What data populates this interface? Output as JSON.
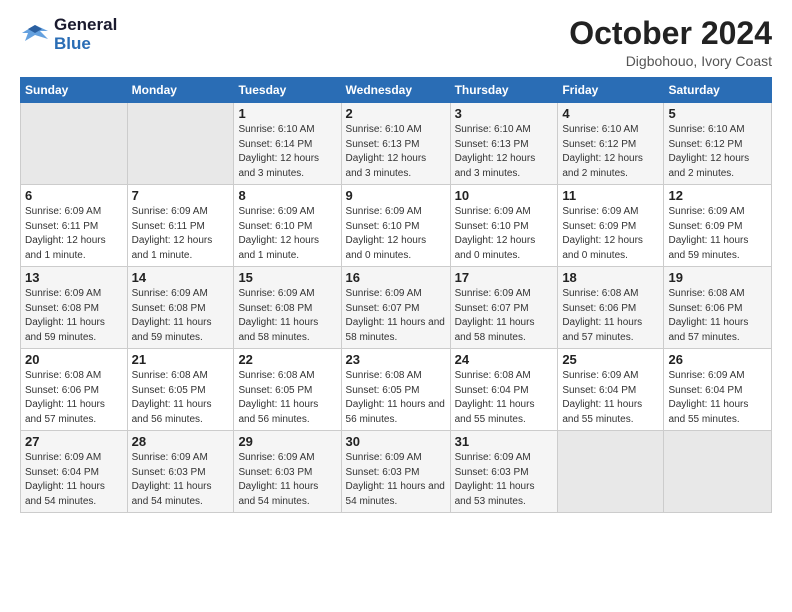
{
  "header": {
    "logo_line1": "General",
    "logo_line2": "Blue",
    "month": "October 2024",
    "location": "Digbohouo, Ivory Coast"
  },
  "weekdays": [
    "Sunday",
    "Monday",
    "Tuesday",
    "Wednesday",
    "Thursday",
    "Friday",
    "Saturday"
  ],
  "weeks": [
    [
      {
        "day": "",
        "info": ""
      },
      {
        "day": "",
        "info": ""
      },
      {
        "day": "1",
        "info": "Sunrise: 6:10 AM\nSunset: 6:14 PM\nDaylight: 12 hours and 3 minutes."
      },
      {
        "day": "2",
        "info": "Sunrise: 6:10 AM\nSunset: 6:13 PM\nDaylight: 12 hours and 3 minutes."
      },
      {
        "day": "3",
        "info": "Sunrise: 6:10 AM\nSunset: 6:13 PM\nDaylight: 12 hours and 3 minutes."
      },
      {
        "day": "4",
        "info": "Sunrise: 6:10 AM\nSunset: 6:12 PM\nDaylight: 12 hours and 2 minutes."
      },
      {
        "day": "5",
        "info": "Sunrise: 6:10 AM\nSunset: 6:12 PM\nDaylight: 12 hours and 2 minutes."
      }
    ],
    [
      {
        "day": "6",
        "info": "Sunrise: 6:09 AM\nSunset: 6:11 PM\nDaylight: 12 hours and 1 minute."
      },
      {
        "day": "7",
        "info": "Sunrise: 6:09 AM\nSunset: 6:11 PM\nDaylight: 12 hours and 1 minute."
      },
      {
        "day": "8",
        "info": "Sunrise: 6:09 AM\nSunset: 6:10 PM\nDaylight: 12 hours and 1 minute."
      },
      {
        "day": "9",
        "info": "Sunrise: 6:09 AM\nSunset: 6:10 PM\nDaylight: 12 hours and 0 minutes."
      },
      {
        "day": "10",
        "info": "Sunrise: 6:09 AM\nSunset: 6:10 PM\nDaylight: 12 hours and 0 minutes."
      },
      {
        "day": "11",
        "info": "Sunrise: 6:09 AM\nSunset: 6:09 PM\nDaylight: 12 hours and 0 minutes."
      },
      {
        "day": "12",
        "info": "Sunrise: 6:09 AM\nSunset: 6:09 PM\nDaylight: 11 hours and 59 minutes."
      }
    ],
    [
      {
        "day": "13",
        "info": "Sunrise: 6:09 AM\nSunset: 6:08 PM\nDaylight: 11 hours and 59 minutes."
      },
      {
        "day": "14",
        "info": "Sunrise: 6:09 AM\nSunset: 6:08 PM\nDaylight: 11 hours and 59 minutes."
      },
      {
        "day": "15",
        "info": "Sunrise: 6:09 AM\nSunset: 6:08 PM\nDaylight: 11 hours and 58 minutes."
      },
      {
        "day": "16",
        "info": "Sunrise: 6:09 AM\nSunset: 6:07 PM\nDaylight: 11 hours and 58 minutes."
      },
      {
        "day": "17",
        "info": "Sunrise: 6:09 AM\nSunset: 6:07 PM\nDaylight: 11 hours and 58 minutes."
      },
      {
        "day": "18",
        "info": "Sunrise: 6:08 AM\nSunset: 6:06 PM\nDaylight: 11 hours and 57 minutes."
      },
      {
        "day": "19",
        "info": "Sunrise: 6:08 AM\nSunset: 6:06 PM\nDaylight: 11 hours and 57 minutes."
      }
    ],
    [
      {
        "day": "20",
        "info": "Sunrise: 6:08 AM\nSunset: 6:06 PM\nDaylight: 11 hours and 57 minutes."
      },
      {
        "day": "21",
        "info": "Sunrise: 6:08 AM\nSunset: 6:05 PM\nDaylight: 11 hours and 56 minutes."
      },
      {
        "day": "22",
        "info": "Sunrise: 6:08 AM\nSunset: 6:05 PM\nDaylight: 11 hours and 56 minutes."
      },
      {
        "day": "23",
        "info": "Sunrise: 6:08 AM\nSunset: 6:05 PM\nDaylight: 11 hours and 56 minutes."
      },
      {
        "day": "24",
        "info": "Sunrise: 6:08 AM\nSunset: 6:04 PM\nDaylight: 11 hours and 55 minutes."
      },
      {
        "day": "25",
        "info": "Sunrise: 6:09 AM\nSunset: 6:04 PM\nDaylight: 11 hours and 55 minutes."
      },
      {
        "day": "26",
        "info": "Sunrise: 6:09 AM\nSunset: 6:04 PM\nDaylight: 11 hours and 55 minutes."
      }
    ],
    [
      {
        "day": "27",
        "info": "Sunrise: 6:09 AM\nSunset: 6:04 PM\nDaylight: 11 hours and 54 minutes."
      },
      {
        "day": "28",
        "info": "Sunrise: 6:09 AM\nSunset: 6:03 PM\nDaylight: 11 hours and 54 minutes."
      },
      {
        "day": "29",
        "info": "Sunrise: 6:09 AM\nSunset: 6:03 PM\nDaylight: 11 hours and 54 minutes."
      },
      {
        "day": "30",
        "info": "Sunrise: 6:09 AM\nSunset: 6:03 PM\nDaylight: 11 hours and 54 minutes."
      },
      {
        "day": "31",
        "info": "Sunrise: 6:09 AM\nSunset: 6:03 PM\nDaylight: 11 hours and 53 minutes."
      },
      {
        "day": "",
        "info": ""
      },
      {
        "day": "",
        "info": ""
      }
    ]
  ]
}
